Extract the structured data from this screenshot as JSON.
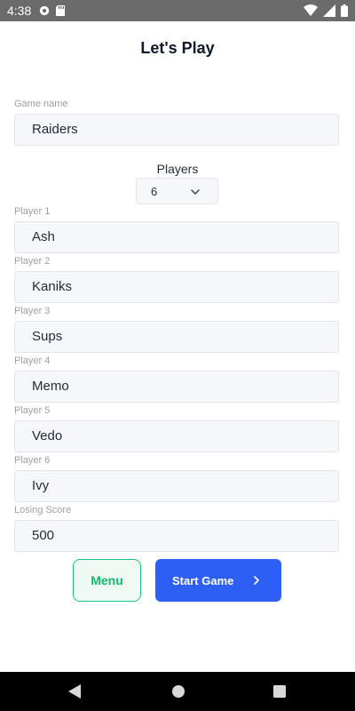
{
  "status_bar": {
    "time": "4:38",
    "icons": [
      "app-notification-icon",
      "sd-card-icon",
      "wifi-icon",
      "cellular-signal-icon",
      "battery-icon"
    ]
  },
  "page": {
    "title": "Let's Play"
  },
  "game_name": {
    "label": "Game name",
    "value": "Raiders"
  },
  "players": {
    "label": "Players",
    "selected": "6"
  },
  "player_fields": [
    {
      "label": "Player 1",
      "value": "Ash"
    },
    {
      "label": "Player 2",
      "value": "Kaniks"
    },
    {
      "label": "Player 3",
      "value": "Sups"
    },
    {
      "label": "Player 4",
      "value": "Memo"
    },
    {
      "label": "Player 5",
      "value": "Vedo"
    },
    {
      "label": "Player 6",
      "value": "Ivy"
    }
  ],
  "losing_score": {
    "label": "Losing Score",
    "value": "500"
  },
  "actions": {
    "menu_label": "Menu",
    "start_label": "Start Game"
  },
  "colors": {
    "status_bar": "#6b6b6b",
    "field_background": "#f6f7fa",
    "menu_accent": "#18c67a",
    "start_button": "#2d5ff4",
    "title_text": "#111827"
  }
}
